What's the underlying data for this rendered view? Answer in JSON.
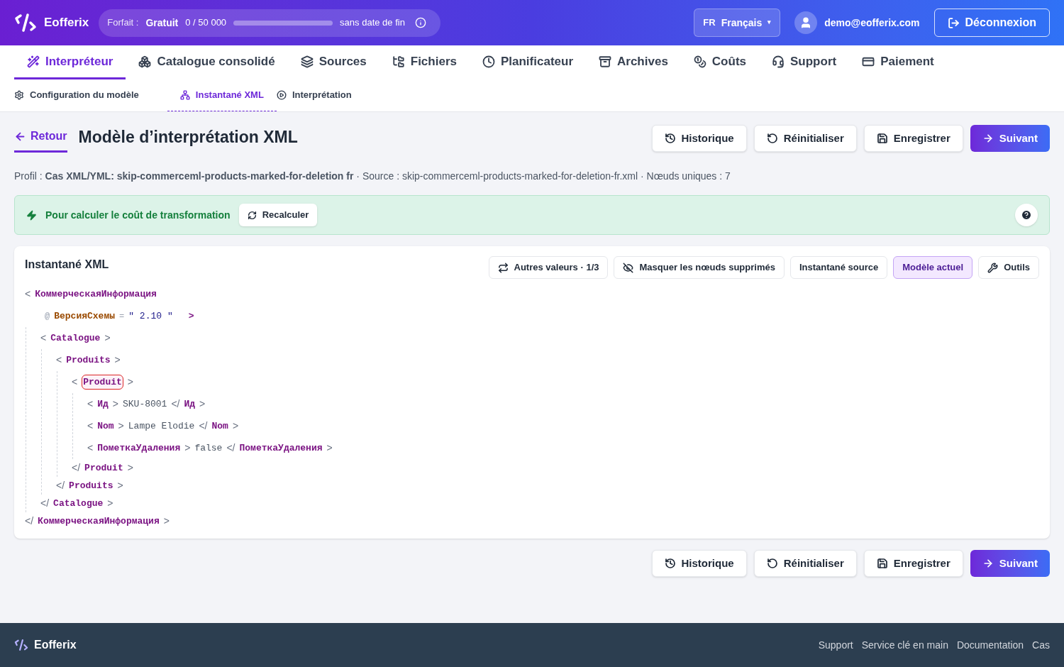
{
  "header": {
    "brand": "Eofferix",
    "plan": {
      "label": "Forfait :",
      "name": "Gratuit",
      "usage": "0 / 50 000",
      "level": 0,
      "expiry": "sans date de fin"
    },
    "language": {
      "code": "FR",
      "name": "Français",
      "caret": "▾"
    },
    "user": "demo@eofferix.com",
    "logout": "Déconnexion"
  },
  "tabs": [
    {
      "label": "Interpréteur",
      "selected": true
    },
    {
      "label": "Catalogue consolidé",
      "selected": false
    },
    {
      "label": "Sources",
      "selected": false
    },
    {
      "label": "Fichiers",
      "selected": false
    },
    {
      "label": "Planificateur",
      "selected": false
    },
    {
      "label": "Archives",
      "selected": false
    },
    {
      "label": "Coûts",
      "selected": false
    },
    {
      "label": "Support",
      "selected": false
    },
    {
      "label": "Paiement",
      "selected": false
    }
  ],
  "subtabs": [
    {
      "label": "Configuration du modèle",
      "selected": false
    },
    {
      "label": "Instantané XML",
      "selected": true
    },
    {
      "label": "Interprétation",
      "selected": false
    }
  ],
  "page": {
    "back": "Retour",
    "title": "Modèle d’interprétation XML",
    "actions": [
      "Historique",
      "Réinitialiser",
      "Enregistrer",
      "Suivant"
    ],
    "info": "Profil : **Cas XML/YML: skip-commerceml-products-marked-for-deletion fr** · Source : skip-commerceml-products-marked-for-deletion-fr.xml · Nœuds uniques : 7"
  },
  "notice": {
    "text": "Pour calculer le coût de transformation",
    "button": "Recalculer"
  },
  "snapshot": {
    "title": "Instantané XML",
    "toolbar": [
      {
        "label": "Autres valeurs · 1/3",
        "selected": false
      },
      {
        "label": "Masquer les nœuds supprimés",
        "selected": false
      },
      {
        "label": "Instantané source",
        "selected": false
      },
      {
        "label": "Modèle actuel",
        "selected": true
      },
      {
        "label": "Outils",
        "selected": false
      }
    ],
    "syntax": {
      "open": "<",
      "close": ">",
      "end": "</",
      "attr": "@",
      "equals": "=",
      "quote": "\""
    },
    "tree": {
      "tag": "КоммерческаяИнформация",
      "closing_tag": "КоммерческаяИнформация",
      "selected": false,
      "attributes": [
        {
          "name": "ВерсияСхемы",
          "value": "2.10"
        }
      ],
      "children": [
        {
          "tag": "Catalogue",
          "closing_tag": "Catalogue",
          "selected": false,
          "children": [
            {
              "tag": "Produits",
              "closing_tag": "Produits",
              "selected": false,
              "children": [
                {
                  "tag": "Produit",
                  "closing_tag": "Produit",
                  "selected": true,
                  "children": [
                    {
                      "tag": "Ид",
                      "closing_tag": "Ид",
                      "selected": false,
                      "text": "SKU-8001"
                    },
                    {
                      "tag": "Nom",
                      "closing_tag": "Nom",
                      "selected": false,
                      "text": "Lampe Elodie"
                    },
                    {
                      "tag": "ПометкаУдаления",
                      "closing_tag": "ПометкаУдаления",
                      "selected": false,
                      "text": "false"
                    }
                  ]
                }
              ]
            }
          ]
        }
      ]
    }
  },
  "bottom_actions": [
    "Historique",
    "Réinitialiser",
    "Enregistrer",
    "Suivant"
  ],
  "footer": {
    "brand": "Eofferix",
    "links": [
      "Support",
      "Service clé en main",
      "Documentation",
      "Cas"
    ]
  }
}
